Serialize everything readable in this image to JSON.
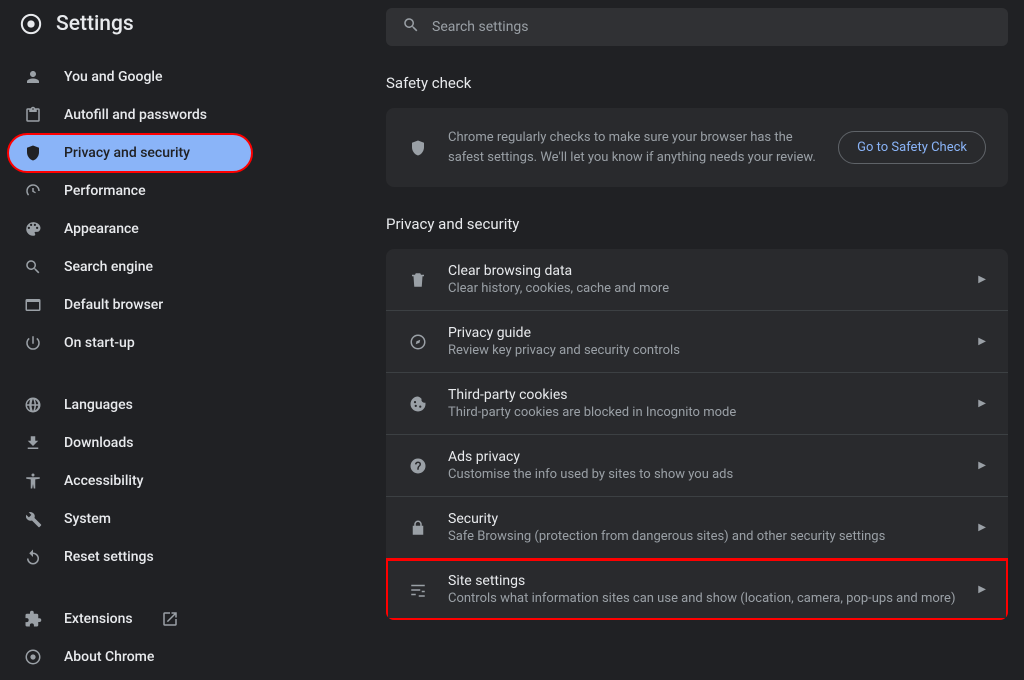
{
  "header": {
    "title": "Settings"
  },
  "search": {
    "placeholder": "Search settings"
  },
  "sidebar": {
    "items": [
      {
        "label": "You and Google"
      },
      {
        "label": "Autofill and passwords"
      },
      {
        "label": "Privacy and security"
      },
      {
        "label": "Performance"
      },
      {
        "label": "Appearance"
      },
      {
        "label": "Search engine"
      },
      {
        "label": "Default browser"
      },
      {
        "label": "On start-up"
      }
    ],
    "items2": [
      {
        "label": "Languages"
      },
      {
        "label": "Downloads"
      },
      {
        "label": "Accessibility"
      },
      {
        "label": "System"
      },
      {
        "label": "Reset settings"
      }
    ],
    "items3": [
      {
        "label": "Extensions"
      },
      {
        "label": "About Chrome"
      }
    ]
  },
  "safety": {
    "title": "Safety check",
    "desc": "Chrome regularly checks to make sure your browser has the safest settings. We'll let you know if anything needs your review.",
    "button": "Go to Safety Check"
  },
  "privacy": {
    "title": "Privacy and security",
    "rows": [
      {
        "title": "Clear browsing data",
        "sub": "Clear history, cookies, cache and more"
      },
      {
        "title": "Privacy guide",
        "sub": "Review key privacy and security controls"
      },
      {
        "title": "Third-party cookies",
        "sub": "Third-party cookies are blocked in Incognito mode"
      },
      {
        "title": "Ads privacy",
        "sub": "Customise the info used by sites to show you ads"
      },
      {
        "title": "Security",
        "sub": "Safe Browsing (protection from dangerous sites) and other security settings"
      },
      {
        "title": "Site settings",
        "sub": "Controls what information sites can use and show (location, camera, pop-ups and more)"
      }
    ]
  }
}
